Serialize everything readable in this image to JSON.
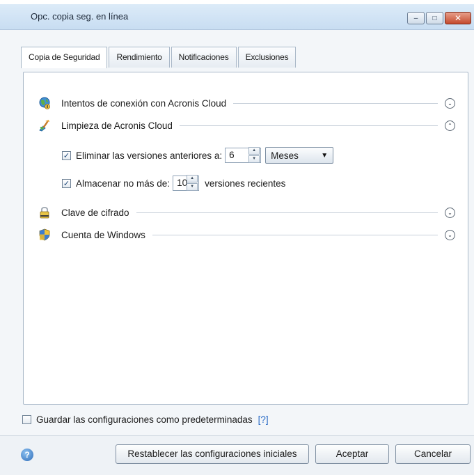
{
  "window": {
    "title": "Opc. copia seg. en línea",
    "buttons": {
      "minimize": "–",
      "maximize": "□",
      "close": "✕"
    }
  },
  "tabs": [
    {
      "label": "Copia de Seguridad",
      "active": true
    },
    {
      "label": "Rendimiento",
      "active": false
    },
    {
      "label": "Notificaciones",
      "active": false
    },
    {
      "label": "Exclusiones",
      "active": false
    }
  ],
  "sections": [
    {
      "label": "Intentos de conexión con Acronis Cloud",
      "icon": "globe-network-icon",
      "expanded": false
    },
    {
      "label": "Limpieza de Acronis Cloud",
      "icon": "broom-icon",
      "expanded": true
    },
    {
      "label": "Clave de cifrado",
      "icon": "padlock-icon",
      "expanded": false
    },
    {
      "label": "Cuenta de Windows",
      "icon": "shield-icon",
      "expanded": false
    }
  ],
  "cleanup": {
    "delete_older": {
      "label": "Eliminar las versiones anteriores a:",
      "checked": true,
      "value": "6",
      "unit": "Meses"
    },
    "keep_recent": {
      "label": "Almacenar no más de:",
      "checked": true,
      "value": "10",
      "suffix": "versiones recientes"
    }
  },
  "save_defaults": {
    "label": "Guardar las configuraciones como predeterminadas",
    "checked": false,
    "help_link": "[?]"
  },
  "footer": {
    "help_icon": "?",
    "reset_label": "Restablecer las configuraciones iniciales",
    "ok_label": "Aceptar",
    "cancel_label": "Cancelar"
  },
  "glyphs": {
    "expand": "⌄",
    "collapse": "⌃",
    "check": "✓",
    "spin_up": "▲",
    "spin_down": "▼",
    "dropdown_arrow": "▼"
  }
}
